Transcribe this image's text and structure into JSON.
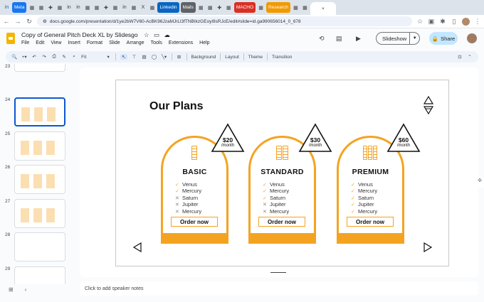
{
  "browser": {
    "tabs": [
      {
        "label": "in",
        "color": "#0a66c2",
        "fav": true
      },
      {
        "label": "Meta",
        "color": "#1877f2"
      },
      {
        "label": "▦",
        "fav": true
      },
      {
        "label": "▦",
        "fav": true
      },
      {
        "label": "✚",
        "fav": true
      },
      {
        "label": "▦",
        "fav": true
      },
      {
        "label": "in",
        "fav": true
      },
      {
        "label": "in",
        "fav": true
      },
      {
        "label": "▦",
        "fav": true
      },
      {
        "label": "▦",
        "fav": true
      },
      {
        "label": "✚",
        "fav": true
      },
      {
        "label": "▦",
        "fav": true
      },
      {
        "label": "in",
        "fav": true
      },
      {
        "label": "▦",
        "fav": true
      },
      {
        "label": "X",
        "fav": true
      },
      {
        "label": "▦",
        "fav": true
      },
      {
        "label": "Linkedin",
        "color": "#0a66c2"
      },
      {
        "label": "Mails",
        "color": "#5f6368"
      },
      {
        "label": "▦",
        "fav": true
      },
      {
        "label": "▦",
        "fav": true
      },
      {
        "label": "✚",
        "fav": true
      },
      {
        "label": "▦",
        "fav": true
      },
      {
        "label": "MACHO",
        "color": "#d93025"
      },
      {
        "label": "▦",
        "fav": true
      },
      {
        "label": "Research",
        "color": "#f29900"
      },
      {
        "label": "▦",
        "fav": true
      },
      {
        "label": "▦",
        "fav": true
      }
    ],
    "url": "docs.google.com/presentation/d/1ye2bW7V60-AcBK96JzaMJrLl3fTNBIkzGEoyi9sRJcE/edit#slide=id.ga990656014_0_678"
  },
  "app": {
    "doc_title": "Copy of General Pitch Deck XL by Slidesgo",
    "menus": [
      "File",
      "Edit",
      "View",
      "Insert",
      "Format",
      "Slide",
      "Arrange",
      "Tools",
      "Extensions",
      "Help"
    ],
    "slideshow_label": "Slideshow",
    "share_label": "Share"
  },
  "toolbar": {
    "zoom": "Fit",
    "background": "Background",
    "layout": "Layout",
    "theme": "Theme",
    "transition": "Transition"
  },
  "filmstrip": [
    {
      "num": "23"
    },
    {
      "num": "24",
      "selected": true
    },
    {
      "num": "25"
    },
    {
      "num": "26"
    },
    {
      "num": "27"
    },
    {
      "num": "28"
    },
    {
      "num": "29"
    }
  ],
  "slide": {
    "title": "Our Plans",
    "plans": [
      {
        "name": "BASIC",
        "price": "$20",
        "per": "/month",
        "features": [
          {
            "text": "Venus",
            "included": true
          },
          {
            "text": "Mercury",
            "included": true
          },
          {
            "text": "Saturn",
            "included": false
          },
          {
            "text": "Jupiter",
            "included": false
          },
          {
            "text": "Mercury",
            "included": false
          }
        ],
        "button": "Order now"
      },
      {
        "name": "STANDARD",
        "price": "$30",
        "per": "/month",
        "features": [
          {
            "text": "Venus",
            "included": true
          },
          {
            "text": "Mercury",
            "included": true
          },
          {
            "text": "Saturn",
            "included": true
          },
          {
            "text": "Jupiter",
            "included": false
          },
          {
            "text": "Mercury",
            "included": false
          }
        ],
        "button": "Order now"
      },
      {
        "name": "PREMIUM",
        "price": "$60",
        "per": "/month",
        "features": [
          {
            "text": "Venus",
            "included": true
          },
          {
            "text": "Mercury",
            "included": true
          },
          {
            "text": "Saturn",
            "included": true
          },
          {
            "text": "Jupiter",
            "included": true
          },
          {
            "text": "Mercury",
            "included": true
          }
        ],
        "button": "Order now"
      }
    ],
    "accent_color": "#f4a321"
  },
  "notes": {
    "placeholder": "Click to add speaker notes"
  }
}
